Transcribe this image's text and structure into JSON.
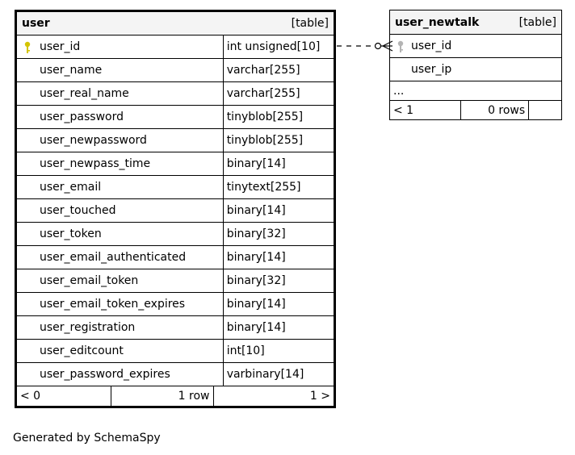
{
  "user_table": {
    "name": "user",
    "kind": "[table]",
    "columns": [
      {
        "name": "user_id",
        "type": "int unsigned[10]",
        "primary_key": true
      },
      {
        "name": "user_name",
        "type": "varchar[255]"
      },
      {
        "name": "user_real_name",
        "type": "varchar[255]"
      },
      {
        "name": "user_password",
        "type": "tinyblob[255]"
      },
      {
        "name": "user_newpassword",
        "type": "tinyblob[255]"
      },
      {
        "name": "user_newpass_time",
        "type": "binary[14]"
      },
      {
        "name": "user_email",
        "type": "tinytext[255]"
      },
      {
        "name": "user_touched",
        "type": "binary[14]"
      },
      {
        "name": "user_token",
        "type": "binary[32]"
      },
      {
        "name": "user_email_authenticated",
        "type": "binary[14]"
      },
      {
        "name": "user_email_token",
        "type": "binary[32]"
      },
      {
        "name": "user_email_token_expires",
        "type": "binary[14]"
      },
      {
        "name": "user_registration",
        "type": "binary[14]"
      },
      {
        "name": "user_editcount",
        "type": "int[10]"
      },
      {
        "name": "user_password_expires",
        "type": "varbinary[14]"
      }
    ],
    "footer": {
      "parents": "< 0",
      "rows": "1 row",
      "children": "1 >"
    }
  },
  "user_newtalk_table": {
    "name": "user_newtalk",
    "kind": "[table]",
    "columns": [
      {
        "name": "user_id",
        "foreign_key": true
      },
      {
        "name": "user_ip"
      }
    ],
    "ellipsis": "...",
    "footer": {
      "parents": "< 1",
      "rows": "0 rows",
      "children": ""
    }
  },
  "colors": {
    "primary_key_icon": "#d4c400",
    "foreign_key_icon": "#b4b4b4",
    "header_bg": "#f4f4f4"
  },
  "footer_text": "Generated by SchemaSpy"
}
